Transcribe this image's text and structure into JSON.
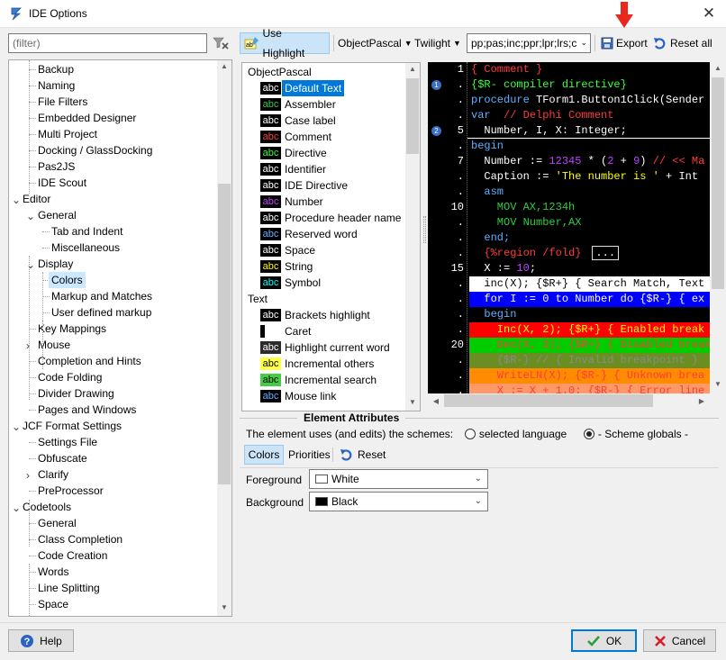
{
  "window": {
    "title": "IDE Options",
    "close": "✕"
  },
  "filter": {
    "placeholder": "(filter)"
  },
  "tree": [
    {
      "label": "Backup",
      "level": 2
    },
    {
      "label": "Naming",
      "level": 2
    },
    {
      "label": "File Filters",
      "level": 2
    },
    {
      "label": "Embedded Designer",
      "level": 2
    },
    {
      "label": "Multi Project",
      "level": 2
    },
    {
      "label": "Docking / GlassDocking",
      "level": 2
    },
    {
      "label": "Pas2JS",
      "level": 2
    },
    {
      "label": "IDE Scout",
      "level": 2
    },
    {
      "label": "Editor",
      "level": 1,
      "expander": "expanded"
    },
    {
      "label": "General",
      "level": 2,
      "expander": "expanded"
    },
    {
      "label": "Tab and Indent",
      "level": 3
    },
    {
      "label": "Miscellaneous",
      "level": 3
    },
    {
      "label": "Display",
      "level": 2,
      "expander": "expanded"
    },
    {
      "label": "Colors",
      "level": 3,
      "selected": true
    },
    {
      "label": "Markup and Matches",
      "level": 3
    },
    {
      "label": "User defined markup",
      "level": 3
    },
    {
      "label": "Key Mappings",
      "level": 2
    },
    {
      "label": "Mouse",
      "level": 2,
      "expander": "collapsed"
    },
    {
      "label": "Completion and Hints",
      "level": 2
    },
    {
      "label": "Code Folding",
      "level": 2
    },
    {
      "label": "Divider Drawing",
      "level": 2
    },
    {
      "label": "Pages and Windows",
      "level": 2
    },
    {
      "label": "JCF Format Settings",
      "level": 1,
      "expander": "expanded"
    },
    {
      "label": "Settings File",
      "level": 2
    },
    {
      "label": "Obfuscate",
      "level": 2
    },
    {
      "label": "Clarify",
      "level": 2,
      "expander": "collapsed"
    },
    {
      "label": "PreProcessor",
      "level": 2
    },
    {
      "label": "Codetools",
      "level": 1,
      "expander": "expanded"
    },
    {
      "label": "General",
      "level": 2
    },
    {
      "label": "Class Completion",
      "level": 2
    },
    {
      "label": "Code Creation",
      "level": 2
    },
    {
      "label": "Words",
      "level": 2
    },
    {
      "label": "Line Splitting",
      "level": 2
    },
    {
      "label": "Space",
      "level": 2
    }
  ],
  "toolbar": {
    "use_highlight": "Use Highlight",
    "language": "ObjectPascal",
    "scheme": "Twilight",
    "extensions": "pp;pas;inc;ppr;lpr;lrs;c",
    "export": "Export",
    "reset_all": "Reset all"
  },
  "elements": {
    "groups": [
      {
        "title": "ObjectPascal",
        "items": [
          {
            "label": "Default Text",
            "swatch_text": "abc",
            "bg": "#000000",
            "fg": "#ffffff",
            "selected": true
          },
          {
            "label": "Assembler",
            "swatch_text": "abc",
            "bg": "#000000",
            "fg": "#2ecc40"
          },
          {
            "label": "Case label",
            "swatch_text": "abc",
            "bg": "#000000",
            "fg": "#ffffff"
          },
          {
            "label": "Comment",
            "swatch_text": "abc",
            "bg": "#000000",
            "fg": "#ff3b3b"
          },
          {
            "label": "Directive",
            "swatch_text": "abc",
            "bg": "#000000",
            "fg": "#3cff3c"
          },
          {
            "label": "Identifier",
            "swatch_text": "abc",
            "bg": "#000000",
            "fg": "#ffffff"
          },
          {
            "label": "IDE Directive",
            "swatch_text": "abc",
            "bg": "#000000",
            "fg": "#ffffff"
          },
          {
            "label": "Number",
            "swatch_text": "abc",
            "bg": "#000000",
            "fg": "#c040ff"
          },
          {
            "label": "Procedure header name",
            "swatch_text": "abc",
            "bg": "#000000",
            "fg": "#ffffff"
          },
          {
            "label": "Reserved word",
            "swatch_text": "abc",
            "bg": "#000000",
            "fg": "#5fb0ff"
          },
          {
            "label": "Space",
            "swatch_text": "abc",
            "bg": "#000000",
            "fg": "#ffffff"
          },
          {
            "label": "String",
            "swatch_text": "abc",
            "bg": "#000000",
            "fg": "#ffff00"
          },
          {
            "label": "Symbol",
            "swatch_text": "abc",
            "bg": "#000000",
            "fg": "#00ffff"
          }
        ]
      },
      {
        "title": "Text",
        "items": [
          {
            "label": "Brackets highlight",
            "swatch_text": "abc",
            "bg": "#000000",
            "fg": "#ffffff"
          },
          {
            "label": "Caret",
            "swatch_text": "",
            "bg": "#ffffff",
            "fg": "#000000",
            "caret": true
          },
          {
            "label": "Highlight current word",
            "swatch_text": "abc",
            "bg": "#2b2b2b",
            "fg": "#ffffff"
          },
          {
            "label": "Incremental others",
            "swatch_text": "abc",
            "bg": "#ffff44",
            "fg": "#000000"
          },
          {
            "label": "Incremental search",
            "swatch_text": "abc",
            "bg": "#44cc44",
            "fg": "#000000"
          },
          {
            "label": "Mouse link",
            "swatch_text": "abc",
            "bg": "#000000",
            "fg": "#5fb0ff"
          }
        ]
      }
    ]
  },
  "preview": {
    "lines": [
      {
        "num": "1",
        "segs": [
          {
            "t": "{ Comment }",
            "c": "#ff3b3b"
          }
        ]
      },
      {
        "num": ".",
        "bp": "1",
        "segs": [
          {
            "t": "{$R- compiler directive}",
            "c": "#3cff3c"
          }
        ]
      },
      {
        "num": ".",
        "segs": [
          {
            "t": "procedure",
            "c": "#5fb0ff"
          },
          {
            "t": " TForm1.Button1Click(Sender",
            "c": "#ffffff"
          }
        ]
      },
      {
        "num": ".",
        "segs": [
          {
            "t": "var",
            "c": "#5fb0ff"
          },
          {
            "t": "  // Delphi Comment",
            "c": "#ff3b3b"
          }
        ]
      },
      {
        "num": "5",
        "bp": "2",
        "segs": [
          {
            "t": "  Number, I, X: Integer;",
            "c": "#ffffff"
          }
        ]
      },
      {
        "num": ".",
        "segs": [
          {
            "t": "begin",
            "c": "#5fb0ff"
          }
        ]
      },
      {
        "num": "7",
        "segs": [
          {
            "t": "  Number := ",
            "c": "#ffffff"
          },
          {
            "t": "12345",
            "c": "#c040ff"
          },
          {
            "t": " * (",
            "c": "#ffffff"
          },
          {
            "t": "2",
            "c": "#c040ff"
          },
          {
            "t": " + ",
            "c": "#ffffff"
          },
          {
            "t": "9",
            "c": "#c040ff"
          },
          {
            "t": ") ",
            "c": "#ffffff"
          },
          {
            "t": "// << Ma",
            "c": "#ff3b3b"
          }
        ]
      },
      {
        "num": ".",
        "segs": [
          {
            "t": "  Caption := ",
            "c": "#ffffff"
          },
          {
            "t": "'The number is '",
            "c": "#ffff00"
          },
          {
            "t": " + Int",
            "c": "#ffffff"
          }
        ]
      },
      {
        "num": ".",
        "segs": [
          {
            "t": "  asm",
            "c": "#5fb0ff"
          }
        ]
      },
      {
        "num": "10",
        "segs": [
          {
            "t": "    MOV AX,1234h",
            "c": "#2ecc40"
          }
        ]
      },
      {
        "num": ".",
        "segs": [
          {
            "t": "    MOV Number,AX",
            "c": "#2ecc40"
          }
        ]
      },
      {
        "num": ".",
        "segs": [
          {
            "t": "  end;",
            "c": "#5fb0ff"
          }
        ]
      },
      {
        "num": ".",
        "segs": [
          {
            "t": "  {%region /fold}",
            "c": "#ff3b3b"
          }
        ],
        "fold": "..."
      },
      {
        "num": "15",
        "segs": [
          {
            "t": "  X := ",
            "c": "#ffffff"
          },
          {
            "t": "10",
            "c": "#c040ff"
          },
          {
            "t": ";",
            "c": "#ffffff"
          }
        ]
      },
      {
        "num": ".",
        "bg": "#ffffff",
        "segs": [
          {
            "t": "  inc(X); {$R+} { Search Match, Text",
            "c": "#000000"
          }
        ]
      },
      {
        "num": ".",
        "bg": "#0000ff",
        "segs": [
          {
            "t": "  for I := 0 to Number do {$R-} { ex",
            "c": "#ffffff"
          }
        ]
      },
      {
        "num": ".",
        "segs": [
          {
            "t": "  begin",
            "c": "#5fb0ff"
          }
        ]
      },
      {
        "num": ".",
        "bg": "#ff0000",
        "segs": [
          {
            "t": "    Inc(X, 2); {$R+} { Enabled break",
            "c": "#ffff00"
          }
        ]
      },
      {
        "num": "20",
        "bg": "#00cc00",
        "segs": [
          {
            "t": "    Dec(X, 3); {$R+} { Disabled break",
            "c": "#ff3b3b"
          }
        ]
      },
      {
        "num": ".",
        "bg": "#6b8e23",
        "segs": [
          {
            "t": "    {$R-} // { Invalid breakpoint }",
            "c": "#8a8a8a"
          }
        ]
      },
      {
        "num": ".",
        "bg": "#ff8c00",
        "segs": [
          {
            "t": "    WriteLN(X); {$R-} { Unknown brea",
            "c": "#ff3b3b"
          }
        ]
      },
      {
        "num": ".",
        "bg": "#ff9966",
        "segs": [
          {
            "t": "    X := X + 1.0; {$R-} { Error line",
            "c": "#ff3b3b"
          }
        ]
      }
    ]
  },
  "attributes": {
    "heading": "Element Attributes",
    "schemes_label": "The element uses (and edits) the schemes:",
    "opt_language": "selected language",
    "opt_globals": "- Scheme globals -",
    "tab_colors": "Colors",
    "tab_priorities": "Priorities",
    "reset": "Reset",
    "foreground_label": "Foreground",
    "foreground_value": "White",
    "foreground_color": "#ffffff",
    "background_label": "Background",
    "background_value": "Black",
    "background_color": "#000000"
  },
  "footer": {
    "help": "Help",
    "ok": "OK",
    "cancel": "Cancel"
  }
}
